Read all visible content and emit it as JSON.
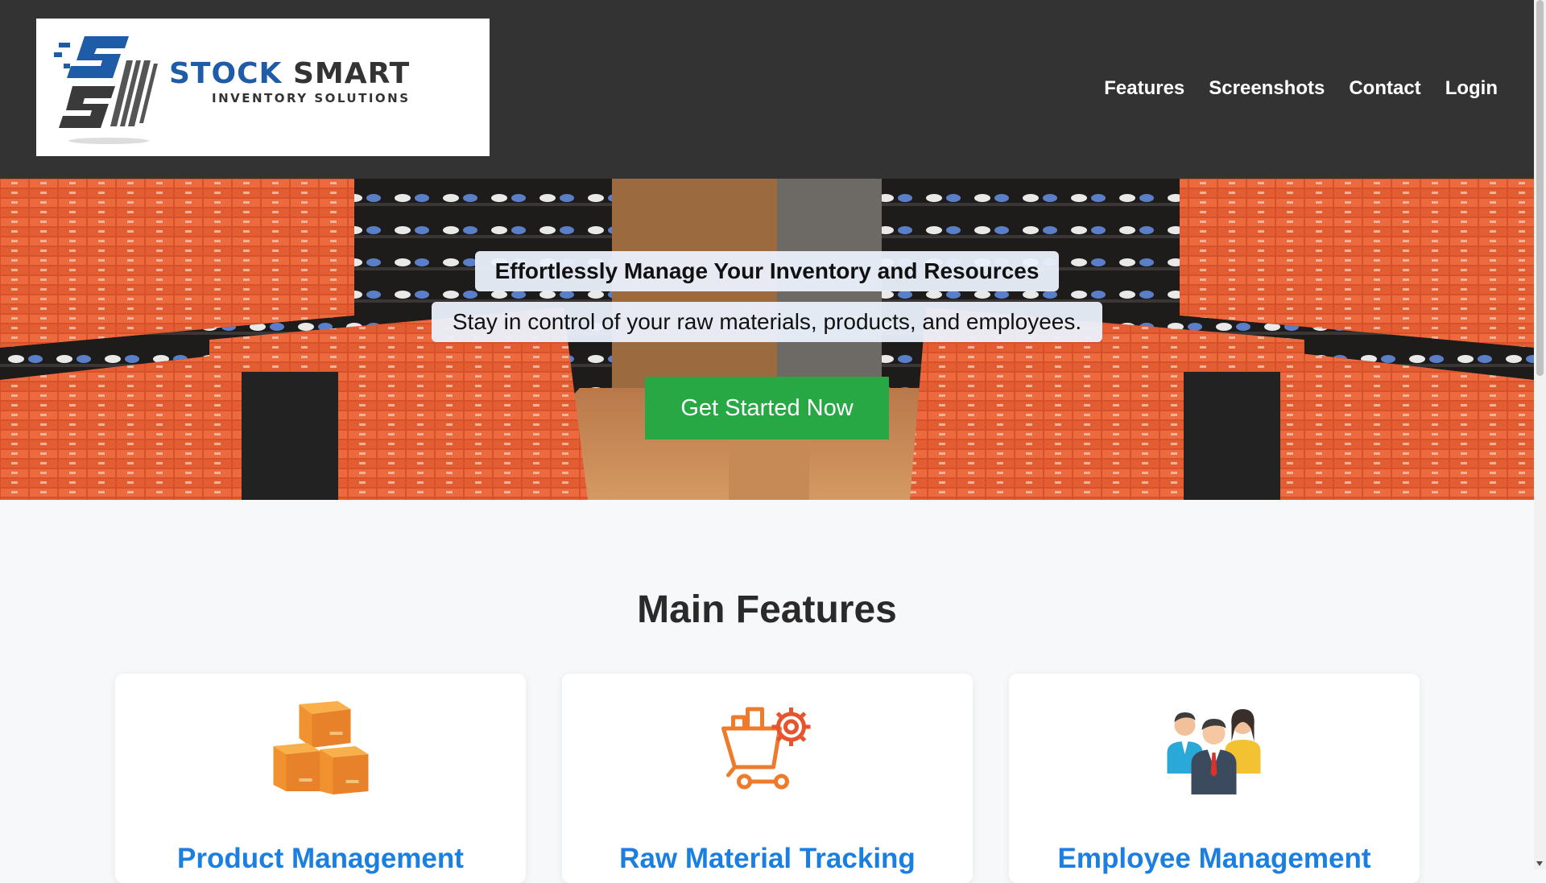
{
  "brand": {
    "name_part1": "STOCK",
    "name_part2": "SMART",
    "tagline": "INVENTORY SOLUTIONS"
  },
  "nav": {
    "items": [
      {
        "label": "Features"
      },
      {
        "label": "Screenshots"
      },
      {
        "label": "Contact"
      },
      {
        "label": "Login"
      }
    ]
  },
  "hero": {
    "title": "Effortlessly Manage Your Inventory and Resources",
    "subtitle": "Stay in control of your raw materials, products, and employees.",
    "cta_label": "Get Started Now",
    "cta_color": "#28a745"
  },
  "features": {
    "heading": "Main Features",
    "cards": [
      {
        "title": "Product Management",
        "icon": "boxes-icon"
      },
      {
        "title": "Raw Material Tracking",
        "icon": "cart-gear-icon"
      },
      {
        "title": "Employee Management",
        "icon": "team-icon"
      }
    ]
  },
  "colors": {
    "header_bg": "#333333",
    "link_blue": "#1a7fe0",
    "brand_blue": "#1f5ca8"
  }
}
